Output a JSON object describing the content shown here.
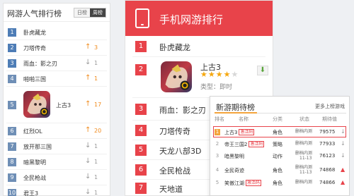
{
  "panel1": {
    "title": "网游人气排行榜",
    "tabs": [
      "日榜",
      "周榜"
    ],
    "items": [
      {
        "rank": "1",
        "name": "卧虎藏龙",
        "trend": "",
        "change": ""
      },
      {
        "rank": "2",
        "name": "刀塔传奇",
        "trend": "up",
        "change": "3"
      },
      {
        "rank": "3",
        "name": "雨血：影之刃",
        "trend": "down",
        "change": "1"
      },
      {
        "rank": "4",
        "name": "啪啪三国",
        "trend": "up",
        "change": "1"
      },
      {
        "rank": "5",
        "name": "上古3",
        "trend": "up",
        "change": "17"
      },
      {
        "rank": "6",
        "name": "红烈OL",
        "trend": "up",
        "change": "20"
      },
      {
        "rank": "7",
        "name": "放开那三国",
        "trend": "down",
        "change": "1"
      },
      {
        "rank": "8",
        "name": "暗黑黎明",
        "trend": "down",
        "change": "1"
      },
      {
        "rank": "9",
        "name": "全民枪战",
        "trend": "down",
        "change": "1"
      },
      {
        "rank": "10",
        "name": "君王3",
        "trend": "down",
        "change": "1"
      }
    ],
    "colors": {
      "rank_bg": "#6f8fb6",
      "up": "#f08a1c",
      "down": "#9a9a9a"
    }
  },
  "panel2": {
    "title": "手机网游排行",
    "items": [
      {
        "rank": "1",
        "name": "卧虎藏龙"
      },
      {
        "rank": "2",
        "name": "上古3",
        "rating": 4,
        "rating_max": 5,
        "type": "类型：即时"
      },
      {
        "rank": "3",
        "name": "雨血：影之刃"
      },
      {
        "rank": "4",
        "name": "刀塔传奇"
      },
      {
        "rank": "5",
        "name": "天龙八部3D"
      },
      {
        "rank": "6",
        "name": "全民枪战"
      },
      {
        "rank": "7",
        "name": "天地道"
      }
    ],
    "colors": {
      "header": "#e8434a"
    }
  },
  "panel3": {
    "title": "新游期待榜",
    "more": "更多上榜游戏",
    "columns": [
      "排名",
      "名称",
      "分类",
      "状态",
      "期待值"
    ],
    "items": [
      {
        "rank": "1",
        "name": "上古3",
        "tag": "激活码",
        "category": "角色",
        "status": "删档内测",
        "status2": "",
        "votes": "79575",
        "trend": "down",
        "highlight": true
      },
      {
        "rank": "2",
        "name": "帝王三国2",
        "tag": "激活码",
        "category": "策略",
        "status": "删档内测",
        "status2": "",
        "votes": "77933",
        "trend": "down"
      },
      {
        "rank": "3",
        "name": "暗黑黎明",
        "tag": "",
        "category": "动作",
        "status": "删档内测",
        "status2": "11-13",
        "votes": "76123",
        "trend": "down"
      },
      {
        "rank": "4",
        "name": "全民奇迹",
        "tag": "",
        "category": "角色",
        "status": "删档内测",
        "status2": "11-13",
        "votes": "74868",
        "trend": "up"
      },
      {
        "rank": "5",
        "name": "笑傲江湖",
        "tag": "激活码",
        "category": "角色",
        "status": "删档内测",
        "status2": "",
        "votes": "74866",
        "trend": "up"
      }
    ],
    "colors": {
      "accent": "#f3a43c",
      "highlight": "#e8434a"
    }
  }
}
